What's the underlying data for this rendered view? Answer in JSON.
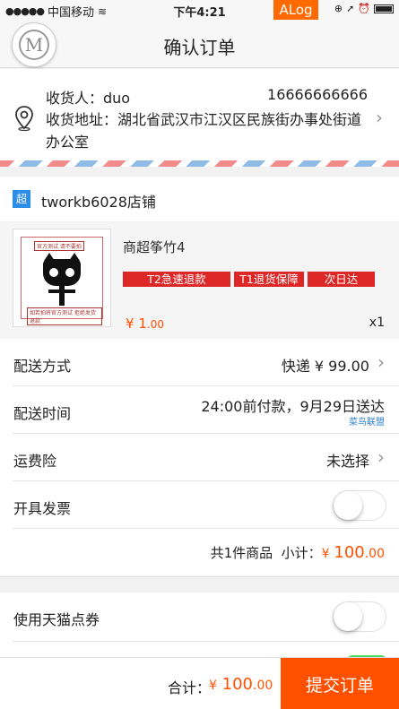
{
  "status_bar": {
    "carrier": "中国移动",
    "time": "下午4:21",
    "alog": "ALog"
  },
  "nav": {
    "title": "确认订单",
    "logo_letter": "M"
  },
  "address": {
    "name_label": "收货人：duo",
    "phone": "16666666666",
    "address_label": "收货地址：湖北省武汉市江汉区民族街办事处街道办公室"
  },
  "shop": {
    "badge": "超",
    "name": "tworkb6028店铺"
  },
  "product": {
    "thumb_text_top": "官方测试 请不要拍",
    "thumb_text_bottom": "如若拍将官方测试 拒绝发货退款",
    "title": "商超筝竹4",
    "tags": [
      "T2急速退款",
      "T1退货保障",
      "次日达"
    ],
    "price_yen": "¥",
    "price_int": "1",
    "price_dec": ".00",
    "qty": "x1"
  },
  "rows": {
    "delivery_label": "配送方式",
    "delivery_value": "快递 ¥ 99.00",
    "time_label": "配送时间",
    "time_value": "24:00前付款，9月29日送达",
    "time_sub": "菜鸟联盟",
    "insurance_label": "运费险",
    "insurance_value": "未选择",
    "invoice_label": "开具发票"
  },
  "summary": {
    "count_text": "共1件商品",
    "subtotal_label": "小计：",
    "yen": "¥",
    "amount_int": "100",
    "amount_dec": ".00"
  },
  "coupon": {
    "label": "使用天猫点券"
  },
  "bottom": {
    "total_label": "合计：",
    "yen": "¥",
    "amount_int": "100",
    "amount_dec": ".00",
    "submit_label": "提交订单"
  },
  "colors": {
    "accent": "#ff5000",
    "tag": "#dd2727",
    "badge": "#2d8de8",
    "link": "#2d7fd3"
  }
}
